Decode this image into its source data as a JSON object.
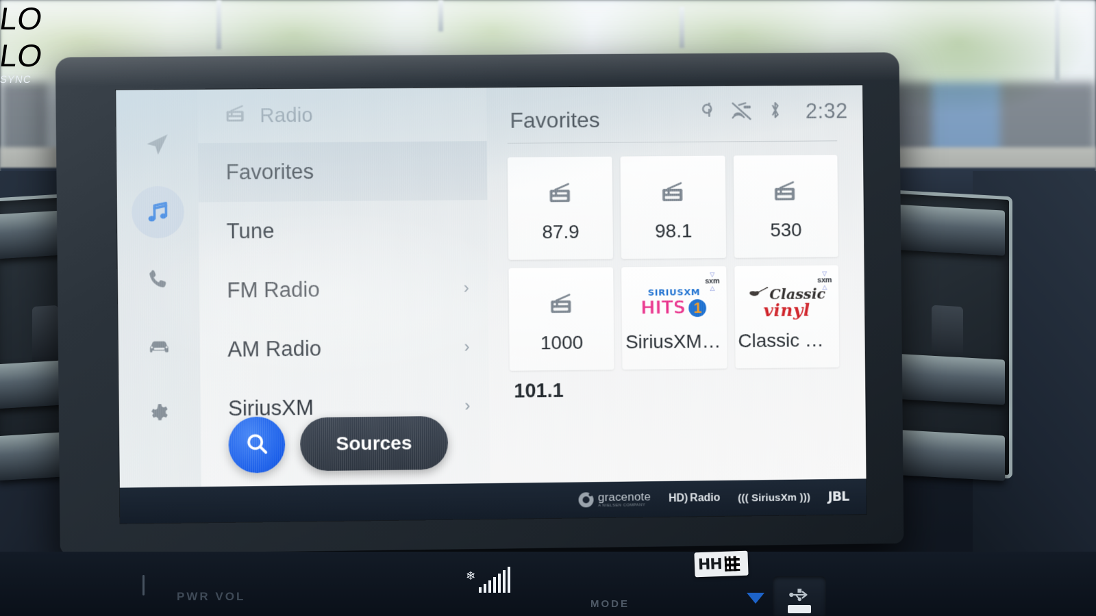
{
  "app": {
    "screen_header": {
      "title": "Radio",
      "icon": "radio-icon"
    },
    "status": {
      "wireless_charge_icon": "qi-wireless-charging-icon",
      "antenna_muted_icon": "antenna-off-icon",
      "bluetooth_icon": "bluetooth-icon",
      "clock": "2:32"
    }
  },
  "sidebar": {
    "items": [
      {
        "name": "navigation",
        "icon": "navigation-arrow-icon",
        "active": false
      },
      {
        "name": "media",
        "icon": "music-note-icon",
        "active": true
      },
      {
        "name": "phone",
        "icon": "phone-icon",
        "active": false
      },
      {
        "name": "vehicle",
        "icon": "car-icon",
        "active": false
      },
      {
        "name": "settings",
        "icon": "gear-icon",
        "active": false
      }
    ]
  },
  "source_list": {
    "items": [
      {
        "label": "Favorites",
        "has_chevron": false,
        "selected": true
      },
      {
        "label": "Tune",
        "has_chevron": false,
        "selected": false
      },
      {
        "label": "FM Radio",
        "has_chevron": true,
        "selected": false
      },
      {
        "label": "AM Radio",
        "has_chevron": true,
        "selected": false
      },
      {
        "label": "SiriusXM",
        "has_chevron": true,
        "selected": false
      }
    ],
    "chevron": "›",
    "search_label": "search-icon",
    "sources_button": "Sources"
  },
  "favorites": {
    "heading": "Favorites",
    "tiles": [
      {
        "name": "87.9",
        "art": "radio-icon",
        "sxm": false
      },
      {
        "name": "98.1",
        "art": "radio-icon",
        "sxm": false
      },
      {
        "name": "530",
        "art": "radio-icon",
        "sxm": false
      },
      {
        "name": "1000",
        "art": "radio-icon",
        "sxm": false
      },
      {
        "name": "SiriusXM …",
        "art": "siriusxm-hits-1-logo",
        "sxm": true
      },
      {
        "name": "Classic V…",
        "art": "classic-vinyl-logo",
        "sxm": true
      }
    ],
    "partial_next": "101.1",
    "sxm_badge_text": "sxm",
    "hits_logo": {
      "top": "SIRIUSXM",
      "word": "HITS",
      "number": "1"
    },
    "vinyl_logo": {
      "word1": "Classic",
      "word2": "vinyl"
    }
  },
  "brandbar": {
    "gracenote": {
      "main": "gracenote",
      "sub": "A NIELSEN COMPANY"
    },
    "hd_radio": {
      "mark": "HD)",
      "word": "Radio"
    },
    "siriusxm": "((( SiriusXm )))",
    "jbl": "JBL"
  },
  "climate": {
    "left_temp": "LO",
    "right_temp": "LO",
    "sync": "SYNC",
    "mode_label": "MODE",
    "power_volume_label": "PWR VOL",
    "fan_icon": "fan-speed-icon",
    "inspection_sticker": "HH"
  },
  "colors": {
    "accent_blue": "#1158e8",
    "screen_bg": "#f2f3f4",
    "rail_bg": "#dbe2e6",
    "brandbar_bg": "#141d29",
    "text_primary": "#22282e",
    "text_muted": "#6d7a87"
  }
}
